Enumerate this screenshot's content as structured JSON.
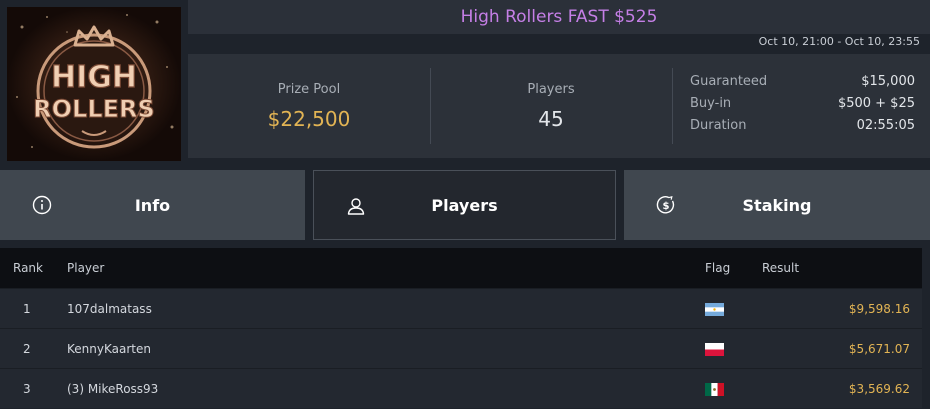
{
  "logo": {
    "line1": "HIGH",
    "line2": "ROLLERS"
  },
  "tournament": {
    "title": "High Rollers FAST $525",
    "datetime": "Oct 10, 21:00 - Oct 10, 23:55"
  },
  "stats": {
    "prize_pool_label": "Prize Pool",
    "prize_pool_value": "$22,500",
    "players_label": "Players",
    "players_value": "45"
  },
  "details": [
    {
      "key": "Guaranteed",
      "value": "$15,000"
    },
    {
      "key": "Buy-in",
      "value": "$500 + $25"
    },
    {
      "key": "Duration",
      "value": "02:55:05"
    }
  ],
  "tabs": [
    {
      "label": "Info",
      "icon": "info-icon",
      "active": false
    },
    {
      "label": "Players",
      "icon": "user-icon",
      "active": true
    },
    {
      "label": "Staking",
      "icon": "dollar-coin-icon",
      "active": false
    }
  ],
  "table": {
    "headers": {
      "rank": "Rank",
      "player": "Player",
      "flag": "Flag",
      "result": "Result"
    },
    "rows": [
      {
        "rank": "1",
        "player": "107dalmatass",
        "flag": "argentina-flag",
        "result": "$9,598.16"
      },
      {
        "rank": "2",
        "player": "KennyKaarten",
        "flag": "poland-flag",
        "result": "$5,671.07"
      },
      {
        "rank": "3",
        "player": "(3) MikeRoss93",
        "flag": "mexico-flag",
        "result": "$3,569.62"
      }
    ]
  },
  "colors": {
    "title": "#c57fe6",
    "gold": "#e2b454",
    "background": "#1e232b",
    "tab_inactive": "#40474f",
    "tab_active": "#23272e"
  }
}
